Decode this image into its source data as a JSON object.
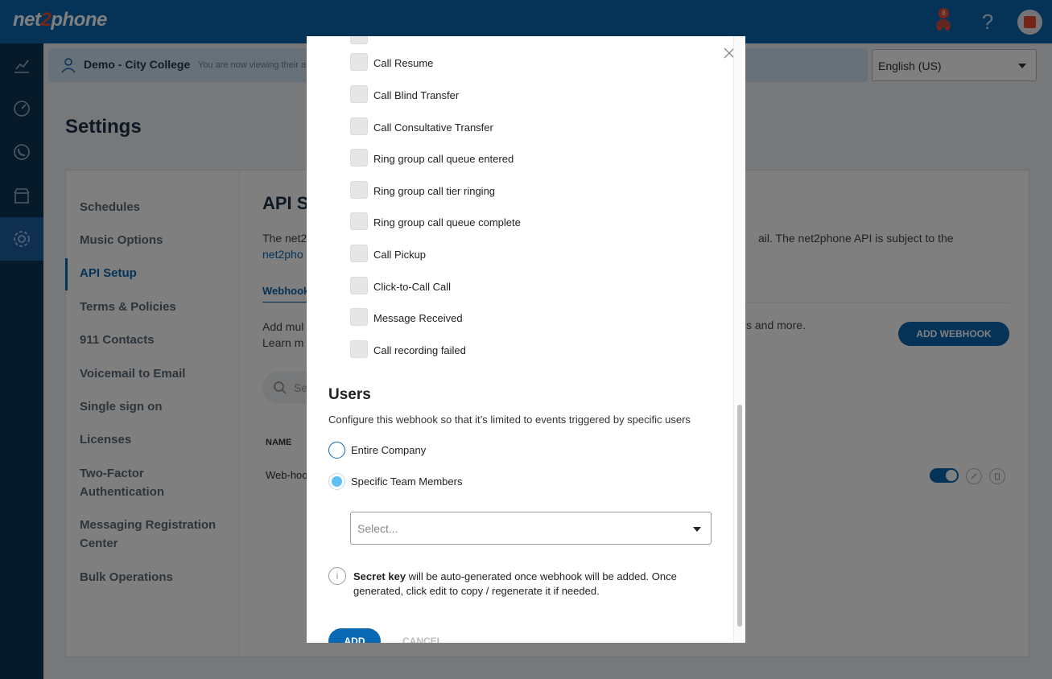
{
  "app": {
    "logo_prefix": "net",
    "logo_two": "2",
    "logo_suffix": "phone",
    "notification_count": "8",
    "help_glyph": "?"
  },
  "banner": {
    "title": "Demo - City College",
    "subtitle": "You are now viewing their a"
  },
  "language": {
    "selected": "English (US)"
  },
  "page": {
    "title": "Settings"
  },
  "settings_menu": {
    "items": [
      {
        "label": "Schedules"
      },
      {
        "label": "Music Options"
      },
      {
        "label": "API Setup"
      },
      {
        "label": "Terms & Policies"
      },
      {
        "label": "911 Contacts"
      },
      {
        "label": "Voicemail to Email"
      },
      {
        "label": "Single sign on"
      },
      {
        "label": "Licenses"
      },
      {
        "label": "Two-Factor Authentication"
      },
      {
        "label": "Messaging Registration Center"
      },
      {
        "label": "Bulk Operations"
      }
    ],
    "active": "API Setup"
  },
  "api": {
    "title": "API S",
    "desc_left": "The net2",
    "desc_right": "ail. The net2phone API is subject to the",
    "link": "net2pho",
    "tab": "Webhook",
    "add_desc_line1": "Add mul",
    "add_desc_line2": "Learn m",
    "add_desc_right": "s and more.",
    "add_button": "ADD WEBHOOK",
    "search_placeholder": "Se",
    "column_name": "NAME",
    "row_name": "Web-hoo"
  },
  "modal": {
    "events": [
      {
        "label": "Call Resume"
      },
      {
        "label": "Call Blind Transfer"
      },
      {
        "label": "Call Consultative Transfer"
      },
      {
        "label": "Ring group call queue entered"
      },
      {
        "label": "Ring group call tier ringing"
      },
      {
        "label": "Ring group call queue complete"
      },
      {
        "label": "Call Pickup"
      },
      {
        "label": "Click-to-Call Call"
      },
      {
        "label": "Message Received"
      },
      {
        "label": "Call recording failed"
      }
    ],
    "users_title": "Users",
    "users_desc": "Configure this webhook so that it’s limited to events triggered by specific users",
    "radio_entire": "Entire Company",
    "radio_specific": "Specific Team Members",
    "selected_scope": "Specific Team Members",
    "select_placeholder": "Select...",
    "secret_bold": "Secret key",
    "secret_rest": " will be auto-generated once webhook will be added. Once generated, click edit to copy / regenerate it if needed.",
    "add_button": "ADD",
    "cancel_button": "CANCEL"
  },
  "colors": {
    "brand": "#0a67b1",
    "nav_bg": "#0e3455",
    "accent": "#e94b35",
    "radio_selected": "#5cc0f2"
  }
}
